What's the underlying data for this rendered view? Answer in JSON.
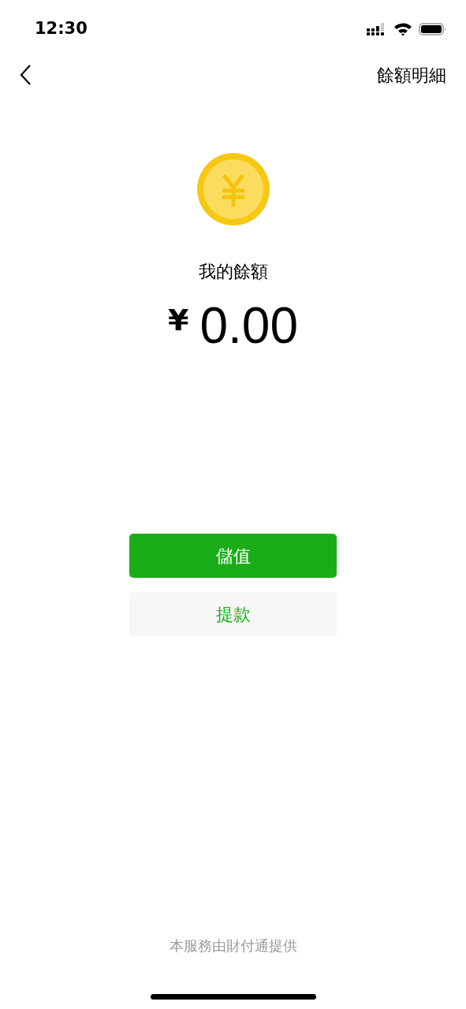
{
  "status_bar": {
    "time": "12:30"
  },
  "nav": {
    "title_action": "餘額明細"
  },
  "balance": {
    "label": "我的餘額",
    "currency": "¥",
    "amount": "0.00"
  },
  "buttons": [
    {
      "label": "儲值",
      "kind": "primary"
    },
    {
      "label": "提款",
      "kind": "secondary"
    }
  ],
  "footer": "本服務由財付通提供"
}
